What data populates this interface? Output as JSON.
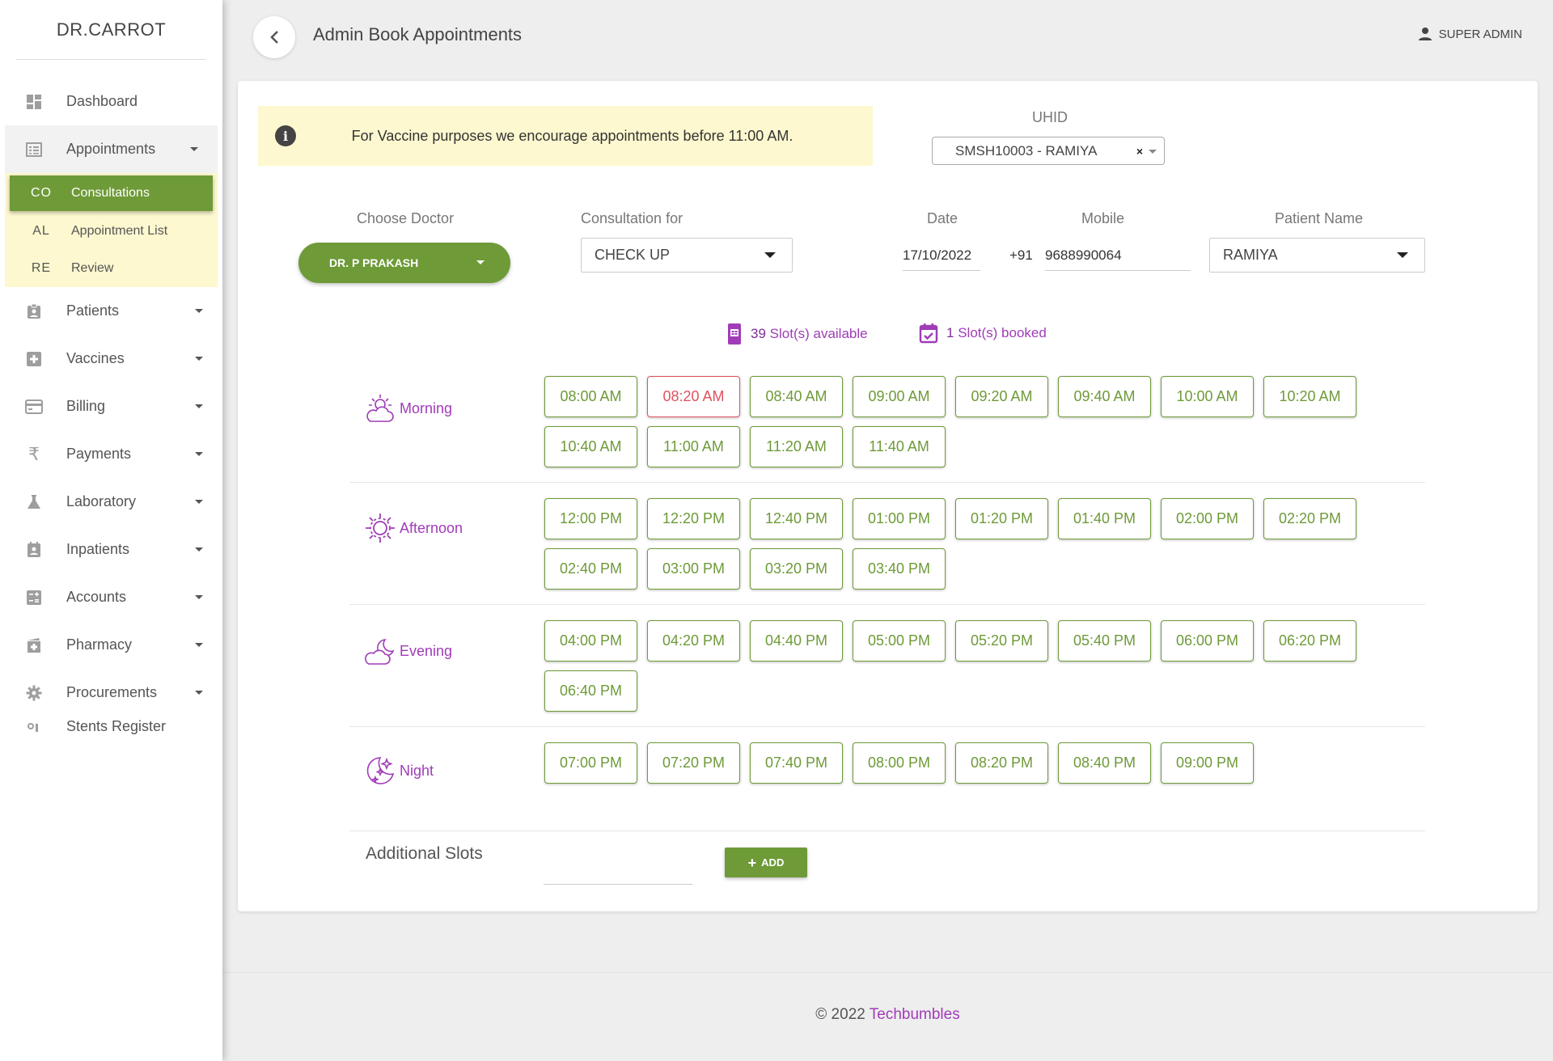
{
  "colors": {
    "accent": "#6e9a38",
    "purple": "#a03cb8",
    "booked": "#e0525f",
    "notice_bg": "#fdf8cf"
  },
  "sidebar": {
    "brand": "DR.CARROT",
    "items": [
      {
        "label": "Dashboard",
        "icon": "dashboard-icon"
      },
      {
        "label": "Appointments",
        "icon": "list-icon"
      },
      {
        "label": "Patients",
        "icon": "badge-icon"
      },
      {
        "label": "Vaccines",
        "icon": "plus-box-icon"
      },
      {
        "label": "Billing",
        "icon": "credit-card-icon"
      },
      {
        "label": "Payments",
        "icon": "rupee-icon"
      },
      {
        "label": "Laboratory",
        "icon": "flask-icon"
      },
      {
        "label": "Inpatients",
        "icon": "contact-icon"
      },
      {
        "label": "Accounts",
        "icon": "calculator-icon"
      },
      {
        "label": "Pharmacy",
        "icon": "pharmacy-icon"
      },
      {
        "label": "Procurements",
        "icon": "gear-icon"
      },
      {
        "label": "Stents Register",
        "icon": "stent-icon"
      }
    ],
    "subitems": [
      {
        "abbr": "CO",
        "label": "Consultations"
      },
      {
        "abbr": "AL",
        "label": "Appointment List"
      },
      {
        "abbr": "RE",
        "label": "Review"
      }
    ]
  },
  "header": {
    "title": "Admin Book Appointments",
    "user": "SUPER ADMIN"
  },
  "notice": {
    "text": "For Vaccine purposes we encourage appointments before 11:00 AM."
  },
  "form": {
    "uhid_label": "UHID",
    "uhid_value": "SMSH10003 - RAMIYA",
    "uhid_clear": "×",
    "doctor_label": "Choose Doctor",
    "doctor_value": "DR. P PRAKASH",
    "consult_label": "Consultation for",
    "consult_value": "CHECK UP",
    "date_label": "Date",
    "date_value": "17/10/2022",
    "mobile_label": "Mobile",
    "mobile_prefix": "+91",
    "mobile_value": "9688990064",
    "patient_label": "Patient Name",
    "patient_value": "RAMIYA"
  },
  "summary": {
    "available_count": "39",
    "available_text": "Slot(s) available",
    "booked_count": "1",
    "booked_text": "Slot(s) booked"
  },
  "periods": [
    {
      "name": "Morning",
      "icon": "cloud-sun-icon",
      "slots": [
        "08:00 AM",
        "08:20 AM",
        "08:40 AM",
        "09:00 AM",
        "09:20 AM",
        "09:40 AM",
        "10:00 AM",
        "10:20 AM",
        "10:40 AM",
        "11:00 AM",
        "11:20 AM",
        "11:40 AM"
      ],
      "booked": [
        "08:20 AM"
      ]
    },
    {
      "name": "Afternoon",
      "icon": "sun-icon",
      "slots": [
        "12:00 PM",
        "12:20 PM",
        "12:40 PM",
        "01:00 PM",
        "01:20 PM",
        "01:40 PM",
        "02:00 PM",
        "02:20 PM",
        "02:40 PM",
        "03:00 PM",
        "03:20 PM",
        "03:40 PM"
      ],
      "booked": []
    },
    {
      "name": "Evening",
      "icon": "cloud-moon-icon",
      "slots": [
        "04:00 PM",
        "04:20 PM",
        "04:40 PM",
        "05:00 PM",
        "05:20 PM",
        "05:40 PM",
        "06:00 PM",
        "06:20 PM",
        "06:40 PM"
      ],
      "booked": []
    },
    {
      "name": "Night",
      "icon": "moon-stars-icon",
      "slots": [
        "07:00 PM",
        "07:20 PM",
        "07:40 PM",
        "08:00 PM",
        "08:20 PM",
        "08:40 PM",
        "09:00 PM"
      ],
      "booked": []
    }
  ],
  "additional": {
    "label": "Additional Slots",
    "add_button": "ADD"
  },
  "footer": {
    "copyright": "© 2022",
    "brand": "Techbumbles"
  }
}
